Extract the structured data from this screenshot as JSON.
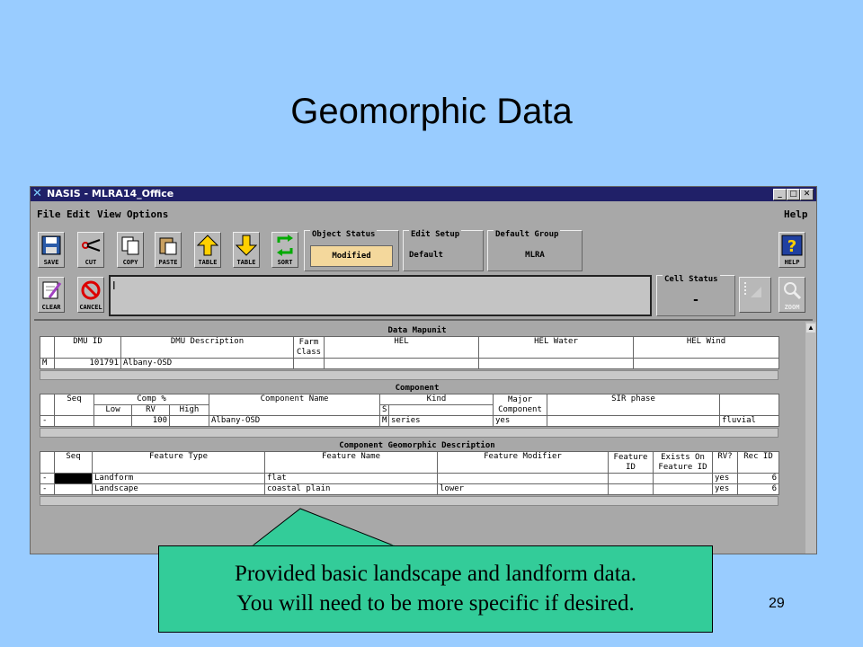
{
  "slide": {
    "title": "Geomorphic Data",
    "page_number": "29"
  },
  "window": {
    "title": "NASIS - MLRA14_Office"
  },
  "menu": {
    "file": "File",
    "edit": "Edit",
    "view": "View",
    "options": "Options",
    "help": "Help"
  },
  "toolbar": {
    "save": "SAVE",
    "cut": "CUT",
    "copy": "COPY",
    "paste": "PASTE",
    "table_up": "TABLE",
    "table_down": "TABLE",
    "sort": "SORT",
    "clear": "CLEAR",
    "cancel": "CANCEL",
    "help": "HELP",
    "zoom": "ZOOM"
  },
  "groups": {
    "object_status": {
      "label": "Object Status",
      "value": "Modified"
    },
    "edit_setup": {
      "label": "Edit Setup",
      "value": "Default"
    },
    "default_group": {
      "label": "Default Group",
      "value": "MLRA"
    },
    "cell_status": {
      "label": "Cell Status",
      "value": "-"
    }
  },
  "command": {
    "cursor": "I"
  },
  "data_mapunit": {
    "title": "Data Mapunit",
    "headers": [
      "DMU ID",
      "DMU Description",
      "Farm Class",
      "HEL",
      "HEL Water",
      "HEL Wind"
    ],
    "row": {
      "marker": "M",
      "dmu_id": "101791",
      "dmu_desc": "Albany-OSD"
    }
  },
  "component": {
    "title": "Component",
    "headers": {
      "seq": "Seq",
      "comp": "Comp %",
      "low": "Low",
      "rv": "RV",
      "high": "High",
      "name": "Component Name",
      "s": "S",
      "kind": "Kind",
      "major": "Major Component",
      "sir": "SIR phase"
    },
    "row": {
      "marker": "-",
      "rv": "100",
      "name": "Albany-OSD",
      "s": "M",
      "kind": "series",
      "major": "yes",
      "last": "fluvial"
    }
  },
  "geomorph": {
    "title": "Component Geomorphic Description",
    "headers": {
      "seq": "Seq",
      "type": "Feature Type",
      "name": "Feature Name",
      "modifier": "Feature Modifier",
      "fid": "Feature ID",
      "exists": "Exists On Feature ID",
      "rv": "RV?",
      "rec": "Rec ID"
    },
    "rows": [
      {
        "marker": "-",
        "type": "Landform",
        "name": "flat",
        "modifier": "",
        "rv": "yes",
        "rec": "6"
      },
      {
        "marker": "-",
        "type": "Landscape",
        "name": "coastal plain",
        "modifier": "lower",
        "rv": "yes",
        "rec": "6"
      }
    ]
  },
  "callout": {
    "line1": "Provided basic landscape and landform data.",
    "line2": "You will need to be more specific if desired."
  }
}
